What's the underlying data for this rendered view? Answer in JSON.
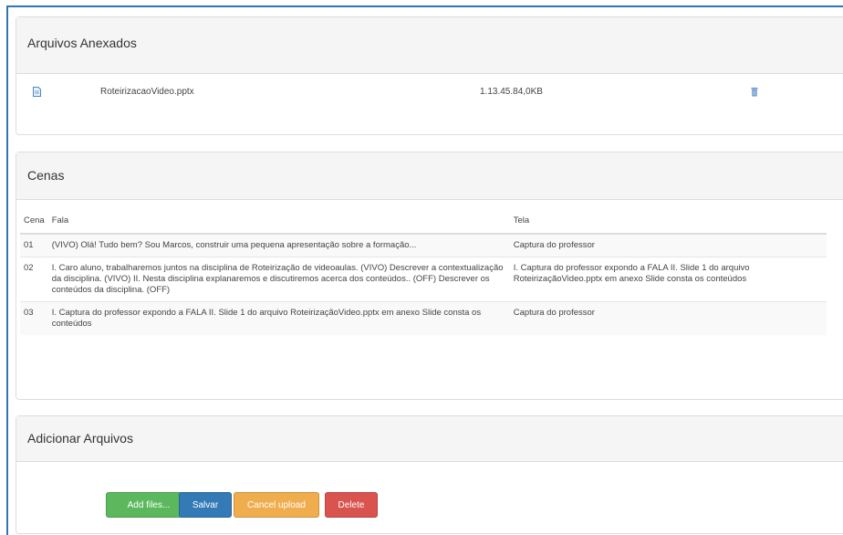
{
  "attachments": {
    "title": "Arquivos Anexados",
    "files": [
      {
        "name": "RoteirizacaoVideo.pptx",
        "size": "1.13.45.84,0KB",
        "file_icon": "document-icon",
        "delete_icon": "trash-icon"
      }
    ]
  },
  "scenes": {
    "title": "Cenas",
    "headers": {
      "cena": "Cena",
      "fala": "Fala",
      "tela": "Tela"
    },
    "rows": [
      {
        "cena": "01",
        "fala": "(VIVO) Olá! Tudo bem? Sou Marcos, construir uma pequena apresentação sobre a formação...",
        "tela": "Captura do professor"
      },
      {
        "cena": "02",
        "fala": "I. Caro aluno, trabalharemos juntos na disciplina de Roteirização de videoaulas. (VIVO) Descrever a contextualização da disciplina. (VIVO) II. Nesta disciplina explanaremos e discutiremos acerca dos conteúdos.. (OFF) Descrever os conteúdos da disciplina. (OFF)",
        "tela": "I. Captura do professor expondo a FALA II. Slide 1 do arquivo RoteirizaçãoVideo.pptx em anexo Slide consta os conteúdos"
      },
      {
        "cena": "03",
        "fala": "I. Captura do professor expondo a FALA II. Slide 1 do arquivo RoteirizaçãoVideo.pptx em anexo Slide consta os conteúdos",
        "tela": "Captura do professor"
      }
    ]
  },
  "upload": {
    "title": "Adicionar Arquivos",
    "buttons": {
      "add": "Add files...",
      "save": "Salvar",
      "cancel": "Cancel upload",
      "delete": "Delete"
    }
  },
  "colors": {
    "frame_border": "#2e75b6",
    "add": "#5cb85c",
    "save": "#337ab7",
    "cancel": "#f0ad4e",
    "delete": "#d9534f"
  }
}
